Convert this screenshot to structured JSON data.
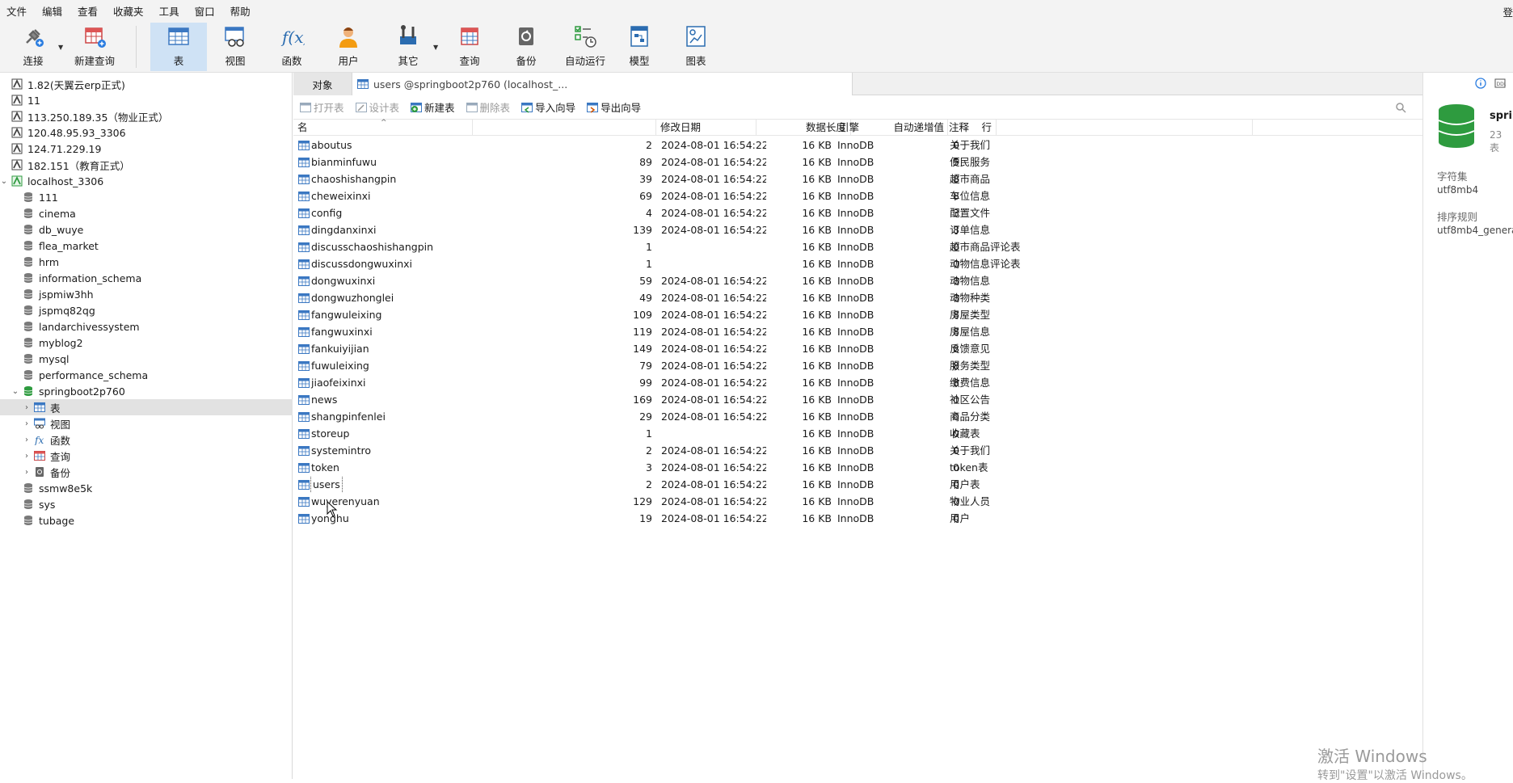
{
  "menu": [
    "文件",
    "编辑",
    "查看",
    "收藏夹",
    "工具",
    "窗口",
    "帮助"
  ],
  "menu_right_partial": "登",
  "toolbar": {
    "connect": "连接",
    "new_query": "新建查询",
    "table": "表",
    "view": "视图",
    "function": "函数",
    "user": "用户",
    "other": "其它",
    "query": "查询",
    "backup": "备份",
    "auto_run": "自动运行",
    "model": "模型",
    "chart": "图表"
  },
  "sidebar": {
    "connections": [
      "1.82(天翼云erp正式)",
      "11",
      "113.250.189.35（物业正式）",
      "120.48.95.93_3306",
      "124.71.229.19",
      "182.151（教育正式）",
      "localhost_3306"
    ],
    "databases_before": [
      "111",
      "cinema",
      "db_wuye",
      "flea_market",
      "hrm",
      "information_schema",
      "jspmiw3hh",
      "jspmq82qg",
      "landarchivessystem",
      "myblog2",
      "mysql",
      "performance_schema",
      "springboot2p760"
    ],
    "db_children": [
      "表",
      "视图",
      "函数",
      "查询",
      "备份"
    ],
    "databases_after": [
      "ssmw8e5k",
      "sys",
      "tubage"
    ]
  },
  "tabs": {
    "objects": "对象",
    "active": "users @springboot2p760 (localhost_..."
  },
  "actions": {
    "open": "打开表",
    "design": "设计表",
    "new": "新建表",
    "delete": "删除表",
    "import": "导入向导",
    "export": "导出向导"
  },
  "columns": {
    "name": "名",
    "auto_inc": "自动递增值",
    "modified": "修改日期",
    "data_len": "数据长度",
    "engine": "引擎",
    "rows": "行",
    "comment": "注释"
  },
  "tables": [
    {
      "name": "aboutus",
      "auto": "2",
      "date": "2024-08-01 16:54:22",
      "size": "16 KB",
      "engine": "InnoDB",
      "rows": "0",
      "comment": "关于我们"
    },
    {
      "name": "bianminfuwu",
      "auto": "89",
      "date": "2024-08-01 16:54:22",
      "size": "16 KB",
      "engine": "InnoDB",
      "rows": "5",
      "comment": "便民服务"
    },
    {
      "name": "chaoshishangpin",
      "auto": "39",
      "date": "2024-08-01 16:54:22",
      "size": "16 KB",
      "engine": "InnoDB",
      "rows": "8",
      "comment": "超市商品"
    },
    {
      "name": "cheweixinxi",
      "auto": "69",
      "date": "2024-08-01 16:54:22",
      "size": "16 KB",
      "engine": "InnoDB",
      "rows": "8",
      "comment": "车位信息"
    },
    {
      "name": "config",
      "auto": "4",
      "date": "2024-08-01 16:54:22",
      "size": "16 KB",
      "engine": "InnoDB",
      "rows": "3",
      "comment": "配置文件"
    },
    {
      "name": "dingdanxinxi",
      "auto": "139",
      "date": "2024-08-01 16:54:22",
      "size": "16 KB",
      "engine": "InnoDB",
      "rows": "8",
      "comment": "订单信息"
    },
    {
      "name": "discusschaoshishangpin",
      "auto": "1",
      "date": "",
      "size": "16 KB",
      "engine": "InnoDB",
      "rows": "0",
      "comment": "超市商品评论表"
    },
    {
      "name": "discussdongwuxinxi",
      "auto": "1",
      "date": "",
      "size": "16 KB",
      "engine": "InnoDB",
      "rows": "0",
      "comment": "动物信息评论表"
    },
    {
      "name": "dongwuxinxi",
      "auto": "59",
      "date": "2024-08-01 16:54:22",
      "size": "16 KB",
      "engine": "InnoDB",
      "rows": "8",
      "comment": "动物信息"
    },
    {
      "name": "dongwuzhonglei",
      "auto": "49",
      "date": "2024-08-01 16:54:22",
      "size": "16 KB",
      "engine": "InnoDB",
      "rows": "8",
      "comment": "动物种类"
    },
    {
      "name": "fangwuleixing",
      "auto": "109",
      "date": "2024-08-01 16:54:22",
      "size": "16 KB",
      "engine": "InnoDB",
      "rows": "8",
      "comment": "房屋类型"
    },
    {
      "name": "fangwuxinxi",
      "auto": "119",
      "date": "2024-08-01 16:54:22",
      "size": "16 KB",
      "engine": "InnoDB",
      "rows": "8",
      "comment": "房屋信息"
    },
    {
      "name": "fankuiyijian",
      "auto": "149",
      "date": "2024-08-01 16:54:22",
      "size": "16 KB",
      "engine": "InnoDB",
      "rows": "8",
      "comment": "反馈意见"
    },
    {
      "name": "fuwuleixing",
      "auto": "79",
      "date": "2024-08-01 16:54:22",
      "size": "16 KB",
      "engine": "InnoDB",
      "rows": "8",
      "comment": "服务类型"
    },
    {
      "name": "jiaofeixinxi",
      "auto": "99",
      "date": "2024-08-01 16:54:22",
      "size": "16 KB",
      "engine": "InnoDB",
      "rows": "8",
      "comment": "缴费信息"
    },
    {
      "name": "news",
      "auto": "169",
      "date": "2024-08-01 16:54:22",
      "size": "16 KB",
      "engine": "InnoDB",
      "rows": "0",
      "comment": "社区公告"
    },
    {
      "name": "shangpinfenlei",
      "auto": "29",
      "date": "2024-08-01 16:54:22",
      "size": "16 KB",
      "engine": "InnoDB",
      "rows": "0",
      "comment": "商品分类"
    },
    {
      "name": "storeup",
      "auto": "1",
      "date": "",
      "size": "16 KB",
      "engine": "InnoDB",
      "rows": "0",
      "comment": "收藏表"
    },
    {
      "name": "systemintro",
      "auto": "2",
      "date": "2024-08-01 16:54:22",
      "size": "16 KB",
      "engine": "InnoDB",
      "rows": "0",
      "comment": "关于我们"
    },
    {
      "name": "token",
      "auto": "3",
      "date": "2024-08-01 16:54:22",
      "size": "16 KB",
      "engine": "InnoDB",
      "rows": "0",
      "comment": "token表"
    },
    {
      "name": "users",
      "auto": "2",
      "date": "2024-08-01 16:54:22",
      "size": "16 KB",
      "engine": "InnoDB",
      "rows": "0",
      "comment": "用户表"
    },
    {
      "name": "wuyerenyuan",
      "auto": "129",
      "date": "2024-08-01 16:54:22",
      "size": "16 KB",
      "engine": "InnoDB",
      "rows": "0",
      "comment": "物业人员"
    },
    {
      "name": "yonghu",
      "auto": "19",
      "date": "2024-08-01 16:54:22",
      "size": "16 KB",
      "engine": "InnoDB",
      "rows": "0",
      "comment": "用户"
    }
  ],
  "right_panel": {
    "db_name": "sprin",
    "count": "23 表",
    "charset_label": "字符集",
    "charset": "utf8mb4",
    "collation_label": "排序规则",
    "collation": "utf8mb4_genera"
  },
  "watermark": {
    "line1": "激活 Windows",
    "line2": "转到\"设置\"以激活 Windows。"
  },
  "colors": {
    "accent": "#cfe2f5",
    "db_green": "#2e9b3f",
    "table_icon": "#3b78c2"
  }
}
